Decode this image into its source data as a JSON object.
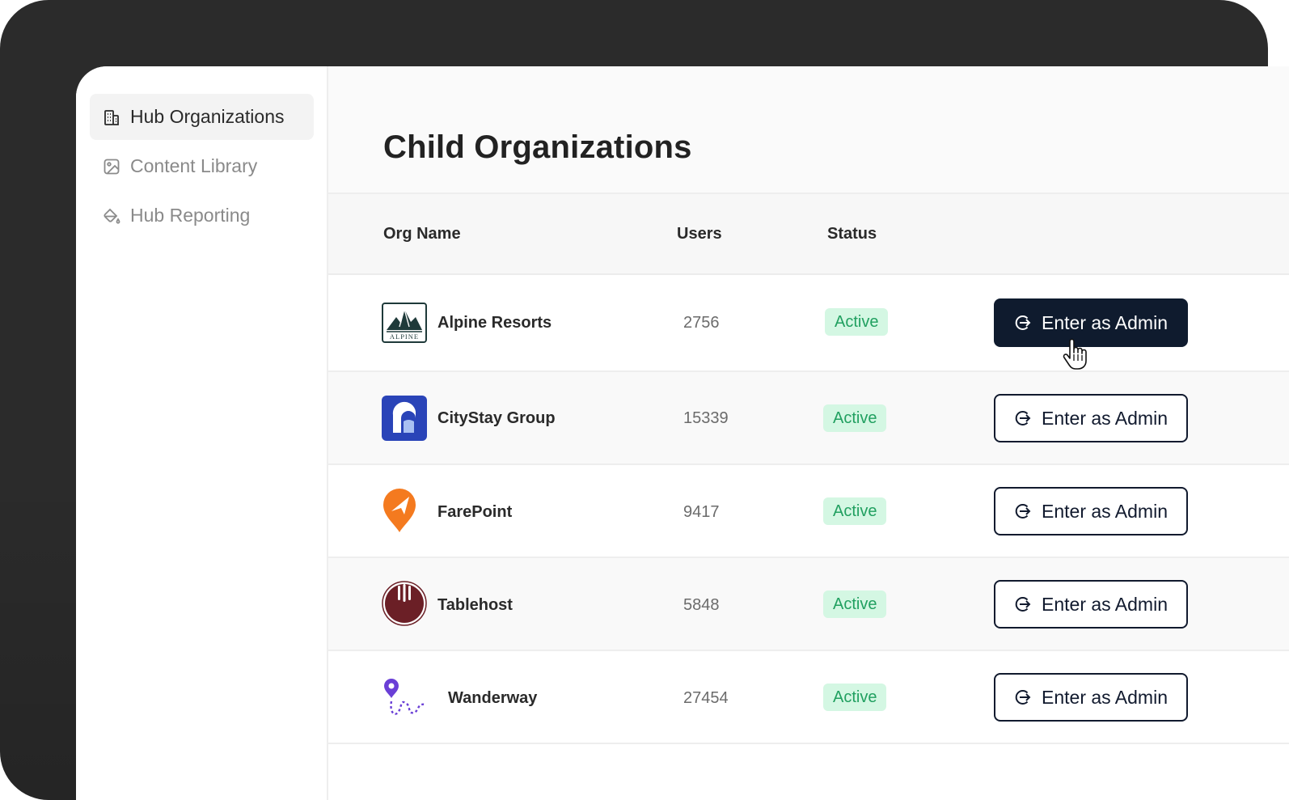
{
  "sidebar": {
    "items": [
      {
        "label": "Hub Organizations",
        "icon": "building-icon",
        "active": true
      },
      {
        "label": "Content Library",
        "icon": "image-icon",
        "active": false
      },
      {
        "label": "Hub Reporting",
        "icon": "paint-bucket-icon",
        "active": false
      }
    ]
  },
  "page": {
    "title": "Child Organizations"
  },
  "table": {
    "headers": {
      "org_name": "Org Name",
      "users": "Users",
      "status": "Status"
    },
    "rows": [
      {
        "name": "Alpine Resorts",
        "users": "2756",
        "status": "Active",
        "action": "Enter as Admin",
        "logo": "alpine-logo",
        "logo_text": "ALPINE"
      },
      {
        "name": "CityStay Group",
        "users": "15339",
        "status": "Active",
        "action": "Enter as Admin",
        "logo": "citystay-logo"
      },
      {
        "name": "FarePoint",
        "users": "9417",
        "status": "Active",
        "action": "Enter as Admin",
        "logo": "farepoint-logo"
      },
      {
        "name": "Tablehost",
        "users": "5848",
        "status": "Active",
        "action": "Enter as Admin",
        "logo": "tablehost-logo"
      },
      {
        "name": "Wanderway",
        "users": "27454",
        "status": "Active",
        "action": "Enter as Admin",
        "logo": "wanderway-logo"
      }
    ]
  },
  "colors": {
    "primary_button": "#0f1b2e",
    "badge_bg": "#d4f7e3",
    "badge_text": "#21a060",
    "frame": "#2b2b2b"
  }
}
